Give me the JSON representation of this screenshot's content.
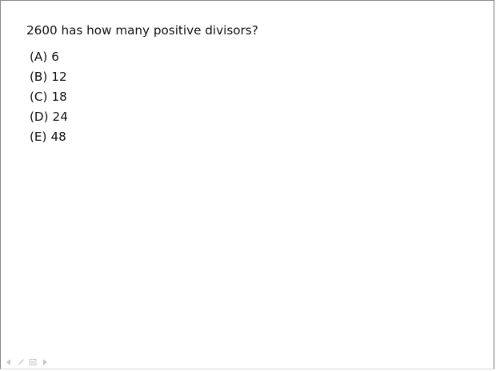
{
  "question": {
    "text": "2600 has how many positive divisors?"
  },
  "options": [
    {
      "letter": "(A)",
      "value": "6"
    },
    {
      "letter": "(B)",
      "value": "12"
    },
    {
      "letter": "(C)",
      "value": "18"
    },
    {
      "letter": "(D)",
      "value": "24"
    },
    {
      "letter": "(E)",
      "value": "48"
    }
  ],
  "toolbar": {
    "icons": [
      "back-arrow-icon",
      "pen-icon",
      "slide-menu-icon",
      "forward-arrow-icon"
    ]
  }
}
